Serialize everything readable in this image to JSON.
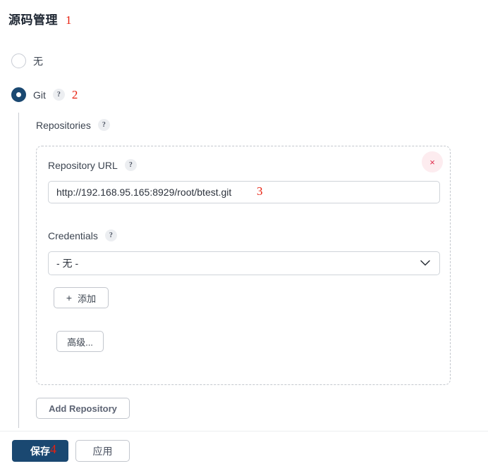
{
  "page": {
    "title": "源码管理",
    "title_annotation": "1"
  },
  "scm_options": {
    "none": {
      "label": "无",
      "selected": false
    },
    "git": {
      "label": "Git",
      "selected": true,
      "help_icon": "?",
      "annotation": "2"
    }
  },
  "repositories": {
    "section_label": "Repositories",
    "section_help_icon": "?",
    "repo": {
      "delete_icon": "×",
      "url_field": {
        "label": "Repository URL",
        "help_icon": "?",
        "value": "http://192.168.95.165:8929/root/btest.git",
        "placeholder": "",
        "annotation": "3"
      },
      "credentials_field": {
        "label": "Credentials",
        "help_icon": "?",
        "selected_option": "- 无 -",
        "chevron_icon": "chevron-down-icon"
      },
      "add_credentials_button": {
        "plus_icon": "+",
        "label": "添加"
      },
      "advanced_button": {
        "label": "高级..."
      }
    },
    "add_repository_button": {
      "label": "Add Repository"
    }
  },
  "footer": {
    "save_button": {
      "label": "保存",
      "annotation": "4"
    },
    "apply_button": {
      "label": "应用"
    }
  },
  "colors": {
    "accent": "#1a4871",
    "annotation_red": "#e8200f",
    "delete_red": "#e02b4c",
    "delete_bg": "#fdecef"
  }
}
